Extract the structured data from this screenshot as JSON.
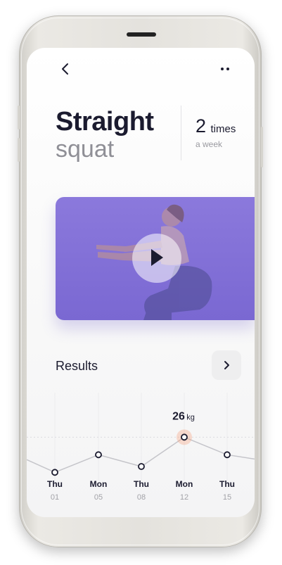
{
  "header": {
    "back_icon": "chevron-left-icon",
    "more_icon": "more-dots-icon"
  },
  "exercise": {
    "title_line1": "Straight",
    "title_line2": "squat",
    "frequency_value": "2",
    "frequency_unit": "times",
    "frequency_period": "a week"
  },
  "video": {
    "play_icon": "play-icon",
    "overlay_color": "#7e6cd7"
  },
  "results": {
    "heading": "Results",
    "next_icon": "chevron-right-icon"
  },
  "chart_data": {
    "type": "line",
    "categories": [
      "Thu 01",
      "Mon 05",
      "Thu 08",
      "Mon 12",
      "Thu 15"
    ],
    "day_labels": [
      "Thu",
      "Mon",
      "Thu",
      "Mon",
      "Thu"
    ],
    "date_labels": [
      "01",
      "05",
      "08",
      "12",
      "15"
    ],
    "values": [
      20,
      23,
      21,
      26,
      23
    ],
    "highlight_index": 3,
    "highlight_value": "26",
    "highlight_unit": "kg",
    "reference_line": 26,
    "ylim": [
      18,
      30
    ],
    "grid": true,
    "accent_color": "#f6a07c"
  },
  "colors": {
    "text_dark": "#1b1b2f",
    "text_muted": "#9a9aa0",
    "accent": "#7e6cd7"
  }
}
